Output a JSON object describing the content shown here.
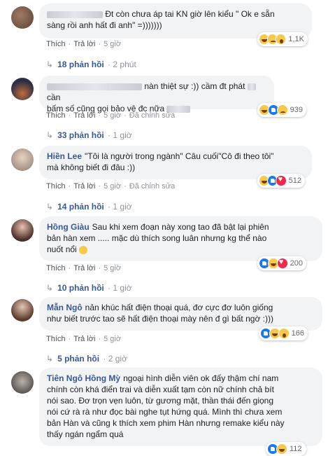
{
  "comments": [
    {
      "author": "",
      "line1": "Đt còn chưa áp tai KN giờ lên kiểu \" Ok e sẵn",
      "line2": "sàng rồi anh hất đi anh\" =)))))))",
      "react_count": "1,1K",
      "like": "Thích",
      "reply": "Trả lời",
      "time": "5 giờ",
      "replies": "18 phản hồi",
      "replies_time": "· 2 phút",
      "reactions": [
        "haha-icon",
        "sad-icon",
        "wow-icon"
      ]
    },
    {
      "author": "",
      "line1": "nàn thiệt sự :)) cầm đt phát",
      "line1b": "cần",
      "line2": "bấm số cũng gọi bảo vệ đc nữa",
      "react_count": "939",
      "like": "Thích",
      "reply": "Trả lời",
      "time": "5 giờ",
      "edited": "Đã chỉnh sửa",
      "replies": "33 phản hồi",
      "replies_time": "· 1 giờ",
      "reactions": [
        "haha-icon",
        "like-icon",
        "sad-icon"
      ]
    },
    {
      "author": "Hiền Lee",
      "line1": "\"Tôi là người trong ngành\" Câu cuối\"Cô đi theo tôi\"",
      "line2": "mà không biết đi đâu :))",
      "react_count": "512",
      "like": "Thích",
      "reply": "Trả lời",
      "time": "5 giờ",
      "edited": "Đã chỉnh sửa",
      "replies": "14 phản hồi",
      "replies_time": "· 1 giờ",
      "reactions": [
        "haha-icon",
        "like-icon",
        "love-icon"
      ]
    },
    {
      "author": "Hồng Giàu",
      "line1": "Sau khi xem đoạn này xong tao đã bật lại phiên",
      "line2": "bản hàn xem ..... mặc dù thích song luân nhưng kg thể nào",
      "line3": "nuốt nổi",
      "react_count": "200",
      "like": "Thích",
      "reply": "Trả lời",
      "time": "5 giờ",
      "replies": "10 phản hồi",
      "replies_time": "· 1 giờ",
      "reactions": [
        "like-icon",
        "haha-icon",
        "love-icon"
      ]
    },
    {
      "author": "Mẫn Ngô",
      "line1": "nản khúc hất điện thoại quá, đơ cực đơ luôn giống",
      "line2": "như biết trước tao sẽ hất điện thoại mày nên đ gì bất ngờ :)))",
      "react_count": "166",
      "like": "Thích",
      "reply": "Trả lời",
      "time": "5 giờ",
      "replies": "5 phản hồi",
      "replies_time": "· 2 giờ",
      "reactions": [
        "like-icon",
        "haha-icon",
        "wow-icon"
      ]
    },
    {
      "author": "Tiên Ngô Hồng Mỳ",
      "line1": "ngoại hình diễn viên ok đấy thậm chí nam",
      "line2": "chính còn khá điển trai và diễn xuất tạm còn nữ chính chả bít",
      "line3": "nói sao. Đơ trọn vẹn luôn, từ gương mặt, thần thái đến giọng",
      "line4": "nói cứ rà rà như đọc bài nghe tụt hứng quá. Mình thì chưa xem",
      "line5": "bản Hàn và cũng k thích xem phim Hàn nhưng remake kiểu này",
      "line6": "thấy ngán ngẩm quá",
      "react_count": "112",
      "reactions": [
        "like-icon",
        "haha-icon"
      ]
    }
  ]
}
